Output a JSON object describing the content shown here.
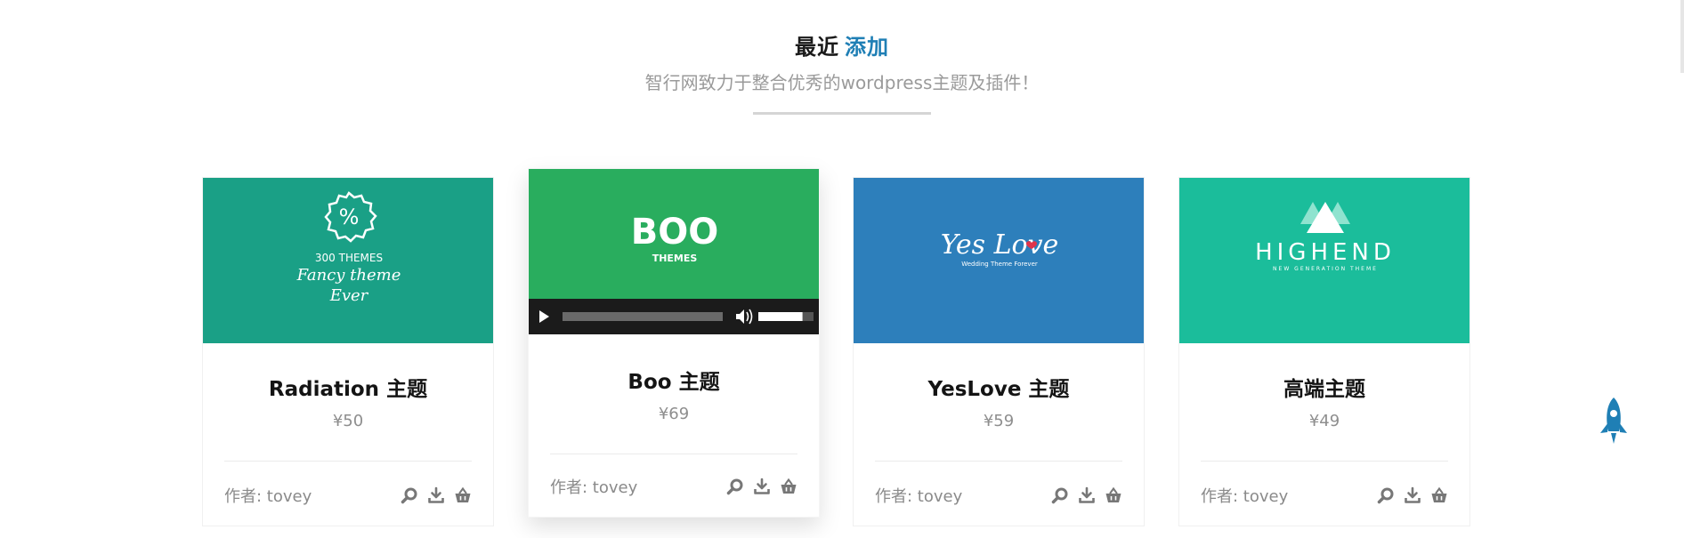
{
  "section": {
    "title_main": "最近",
    "title_accent": "添加",
    "subtitle": "智行网致力于整合优秀的wordpress主题及插件！"
  },
  "colors": {
    "accent": "#1f7fb5",
    "divider": "#d5d5d5",
    "player_bg": "#1b1b1b"
  },
  "cards": [
    {
      "title": "Radiation 主题",
      "price": "¥50",
      "author": "作者: tovey",
      "thumb_bg": "#1aa086",
      "thumb_lines": [
        "%",
        "300 THEMES",
        "Fancy theme",
        "Ever"
      ],
      "icons": [
        "search-icon",
        "download-icon",
        "cart-icon"
      ]
    },
    {
      "title": "Boo 主题",
      "price": "¥69",
      "author": "作者: tovey",
      "thumb_bg": "#29ad5e",
      "thumb_lines": [
        "BOO",
        "THEMES"
      ],
      "icons": [
        "search-icon",
        "download-icon",
        "cart-icon"
      ],
      "player": {
        "play_icon": "play-icon",
        "volume_icon": "volume-icon",
        "volume_level": 0.8
      }
    },
    {
      "title": "YesLove 主题",
      "price": "¥59",
      "author": "作者: tovey",
      "thumb_bg": "#2d7fbb",
      "thumb_lines": [
        "Yes Love",
        "Wedding Theme Forever"
      ],
      "icons": [
        "search-icon",
        "download-icon",
        "cart-icon"
      ]
    },
    {
      "title": "高端主题",
      "price": "¥49",
      "author": "作者: tovey",
      "thumb_bg": "#1bbd9b",
      "thumb_lines": [
        "HIGHEND",
        "NEW GENERATION THEME"
      ],
      "icons": [
        "search-icon",
        "download-icon",
        "cart-icon"
      ]
    }
  ],
  "back_to_top": {
    "icon": "rocket-icon"
  }
}
